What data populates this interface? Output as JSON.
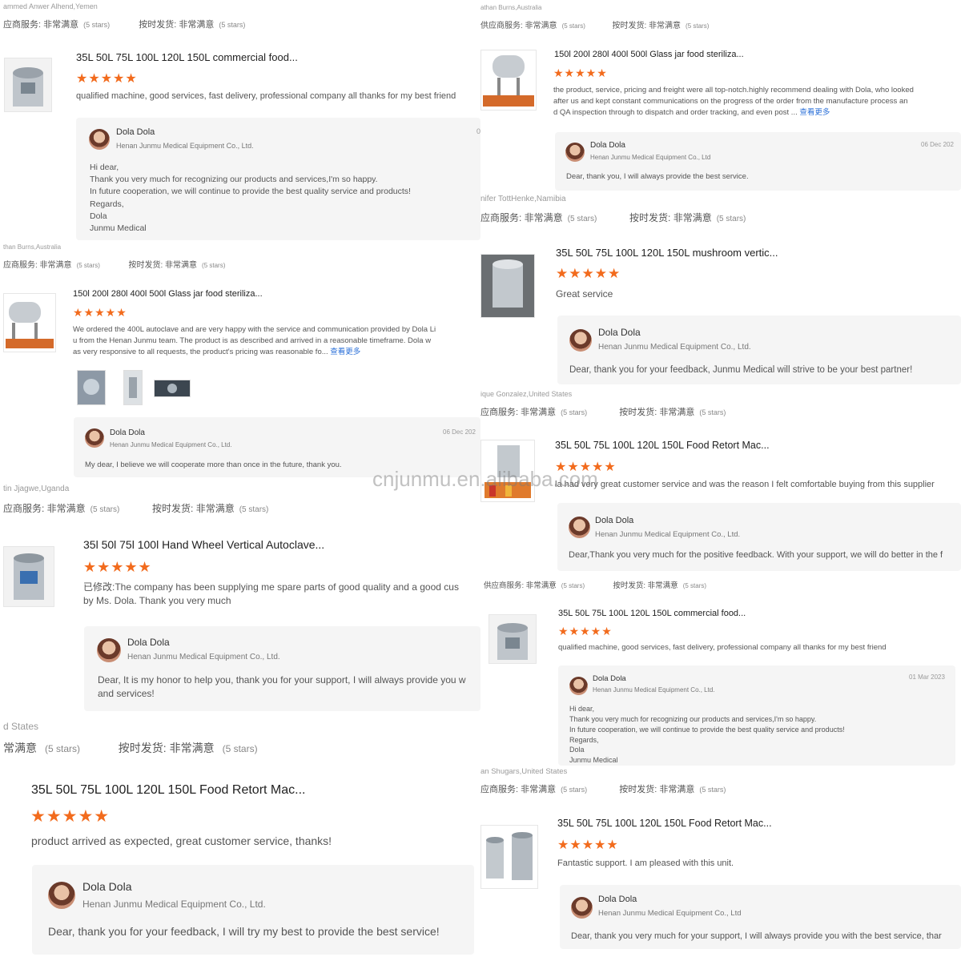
{
  "watermark": "cnjunmu.en.alibaba.com",
  "left": {
    "r1": {
      "reviewer": "ammed Anwer Alhend,Yemen",
      "rating_supplier": "应商服务: 非常满意",
      "rating_supplier_stars": "(5 stars)",
      "rating_ship": "按时发货: 非常满意",
      "rating_ship_stars": "(5 stars)",
      "title": "35L 50L 75L 100L 120L 150L commercial food...",
      "stars": "★★★★★",
      "text": "qualified machine, good services, fast delivery, professional company all thanks for my best friend",
      "reply_name": "Dola Dola",
      "reply_company": "Henan Junmu Medical Equipment Co., Ltd.",
      "reply_date": "0",
      "reply_lines": [
        "Hi dear,",
        "Thank you very much for recognizing our products and services,I'm so happy.",
        "In future cooperation, we will continue to provide the best quality service and products!",
        "Regards,",
        "Dola",
        "Junmu Medical"
      ]
    },
    "r2": {
      "reviewer": "than Burns,Australia",
      "rating_supplier": "应商服务: 非常满意",
      "rating_supplier_stars": "(5 stars)",
      "rating_ship": "按时发货: 非常满意",
      "rating_ship_stars": "(5 stars)",
      "title": "150l 200l 280l 400l 500l Glass jar food steriliza...",
      "stars": "★★★★★",
      "text_lines": [
        "We ordered the 400L autoclave and are very happy with the service and communication provided by Dola Li",
        "u from the Henan Junmu team. The product is as described and arrived in a reasonable timeframe. Dola w",
        "as very responsive to all requests, the product's pricing was reasonable fo..."
      ],
      "more": "查看更多",
      "reply_name": "Dola Dola",
      "reply_company": "Henan Junmu Medical Equipment Co., Ltd.",
      "reply_date": "06 Dec 202",
      "reply_text": "My dear, I believe we will cooperate more than once in the future, thank you."
    },
    "r3": {
      "reviewer": "tin Jjagwe,Uganda",
      "rating_supplier": "应商服务: 非常满意",
      "rating_supplier_stars": "(5 stars)",
      "rating_ship": "按时发货: 非常满意",
      "rating_ship_stars": "(5 stars)",
      "title": "35l 50l 75l 100l Hand Wheel Vertical Autoclave...",
      "stars": "★★★★★",
      "text_lines": [
        "已修改:The company has been supplying me spare parts of good quality and a good cus",
        "by Ms. Dola. Thank you very much"
      ],
      "reply_name": "Dola Dola",
      "reply_company": "Henan Junmu Medical Equipment Co., Ltd.",
      "reply_lines": [
        "Dear, It is my honor to help you, thank you for your support, I will always provide you w",
        "and services!"
      ]
    },
    "r4": {
      "reviewer": "d States",
      "rating_supplier": "常满意",
      "rating_supplier_stars": "(5 stars)",
      "rating_ship": "按时发货: 非常满意",
      "rating_ship_stars": "(5 stars)",
      "title": "35L 50L 75L 100L 120L 150L Food Retort Mac...",
      "stars": "★★★★★",
      "text": "product arrived as expected, great customer service, thanks!",
      "reply_name": "Dola Dola",
      "reply_company": "Henan Junmu Medical Equipment Co., Ltd.",
      "reply_text": "Dear, thank you for your feedback, I will try my best to provide the best service!"
    }
  },
  "right": {
    "r1": {
      "reviewer": "athan Burns,Australia",
      "rating_supplier": "供应商服务: 非常满意",
      "rating_supplier_stars": "(5 stars)",
      "rating_ship": "按时发货: 非常满意",
      "rating_ship_stars": "(5 stars)",
      "title": "150l 200l 280l 400l 500l Glass jar food steriliza...",
      "stars": "★★★★★",
      "text_lines": [
        "the product, service, pricing and freight were all top-notch.highly recommend dealing with Dola, who looked",
        "after us and kept constant communications on the progress of the order from the manufacture process an",
        "d QA inspection through to dispatch and order tracking, and even post ..."
      ],
      "more": "查看更多",
      "reply_name": "Dola Dola",
      "reply_company": "Henan Junmu Medical Equipment Co., Ltd",
      "reply_date": "06 Dec 202",
      "reply_text": "Dear, thank you, I will always provide the best service."
    },
    "r2": {
      "reviewer": "nifer TottHenke,Namibia",
      "rating_supplier": "应商服务: 非常满意",
      "rating_supplier_stars": "(5 stars)",
      "rating_ship": "按时发货: 非常满意",
      "rating_ship_stars": "(5 stars)",
      "title": "35L 50L 75L 100L 120L 150L mushroom vertic...",
      "stars": "★★★★★",
      "text": "Great service",
      "reply_name": "Dola Dola",
      "reply_company": "Henan Junmu Medical Equipment Co., Ltd.",
      "reply_text": "Dear, thank you for your feedback, Junmu Medical will strive to be your best partner!"
    },
    "r3": {
      "reviewer": "ique Gonzalez,United States",
      "rating_supplier": "应商服务: 非常满意",
      "rating_supplier_stars": "(5 stars)",
      "rating_ship": "按时发货: 非常满意",
      "rating_ship_stars": "(5 stars)",
      "title": "35L 50L 75L 100L 120L 150L Food Retort Mac...",
      "stars": "★★★★★",
      "text": "la had very great customer service and was the reason I felt comfortable buying from this supplier",
      "reply_name": "Dola Dola",
      "reply_company": "Henan Junmu Medical Equipment Co., Ltd.",
      "reply_text": "Dear,Thank you very much for the positive feedback. With your support, we will do better in the f"
    },
    "r4": {
      "rating_supplier": "供应商服务: 非常满意",
      "rating_supplier_stars": "(5 stars)",
      "rating_ship": "按时发货: 非常满意",
      "rating_ship_stars": "(5 stars)",
      "title": "35L 50L 75L 100L 120L 150L commercial food...",
      "stars": "★★★★★",
      "text": "qualified machine, good services, fast delivery, professional company all thanks for my best friend",
      "reply_name": "Dola Dola",
      "reply_company": "Henan Junmu Medical Equipment Co., Ltd.",
      "reply_date": "01 Mar 2023",
      "reply_lines": [
        "Hi dear,",
        "Thank you very much for recognizing our products and services,I'm so happy.",
        "In future cooperation, we will continue to provide the best quality service and products!",
        "Regards,",
        "Dola",
        "Junmu Medical"
      ]
    },
    "r5": {
      "reviewer": "an Shugars,United States",
      "rating_supplier": "应商服务: 非常满意",
      "rating_supplier_stars": "(5 stars)",
      "rating_ship": "按时发货: 非常满意",
      "rating_ship_stars": "(5 stars)",
      "title": "35L 50L 75L 100L 120L 150L Food Retort Mac...",
      "stars": "★★★★★",
      "text": "Fantastic support. I am pleased with this unit.",
      "reply_name": "Dola Dola",
      "reply_company": "Henan Junmu Medical Equipment Co., Ltd",
      "reply_text": "Dear, thank you very much for your support, I will always provide you with the best service, thar"
    }
  }
}
